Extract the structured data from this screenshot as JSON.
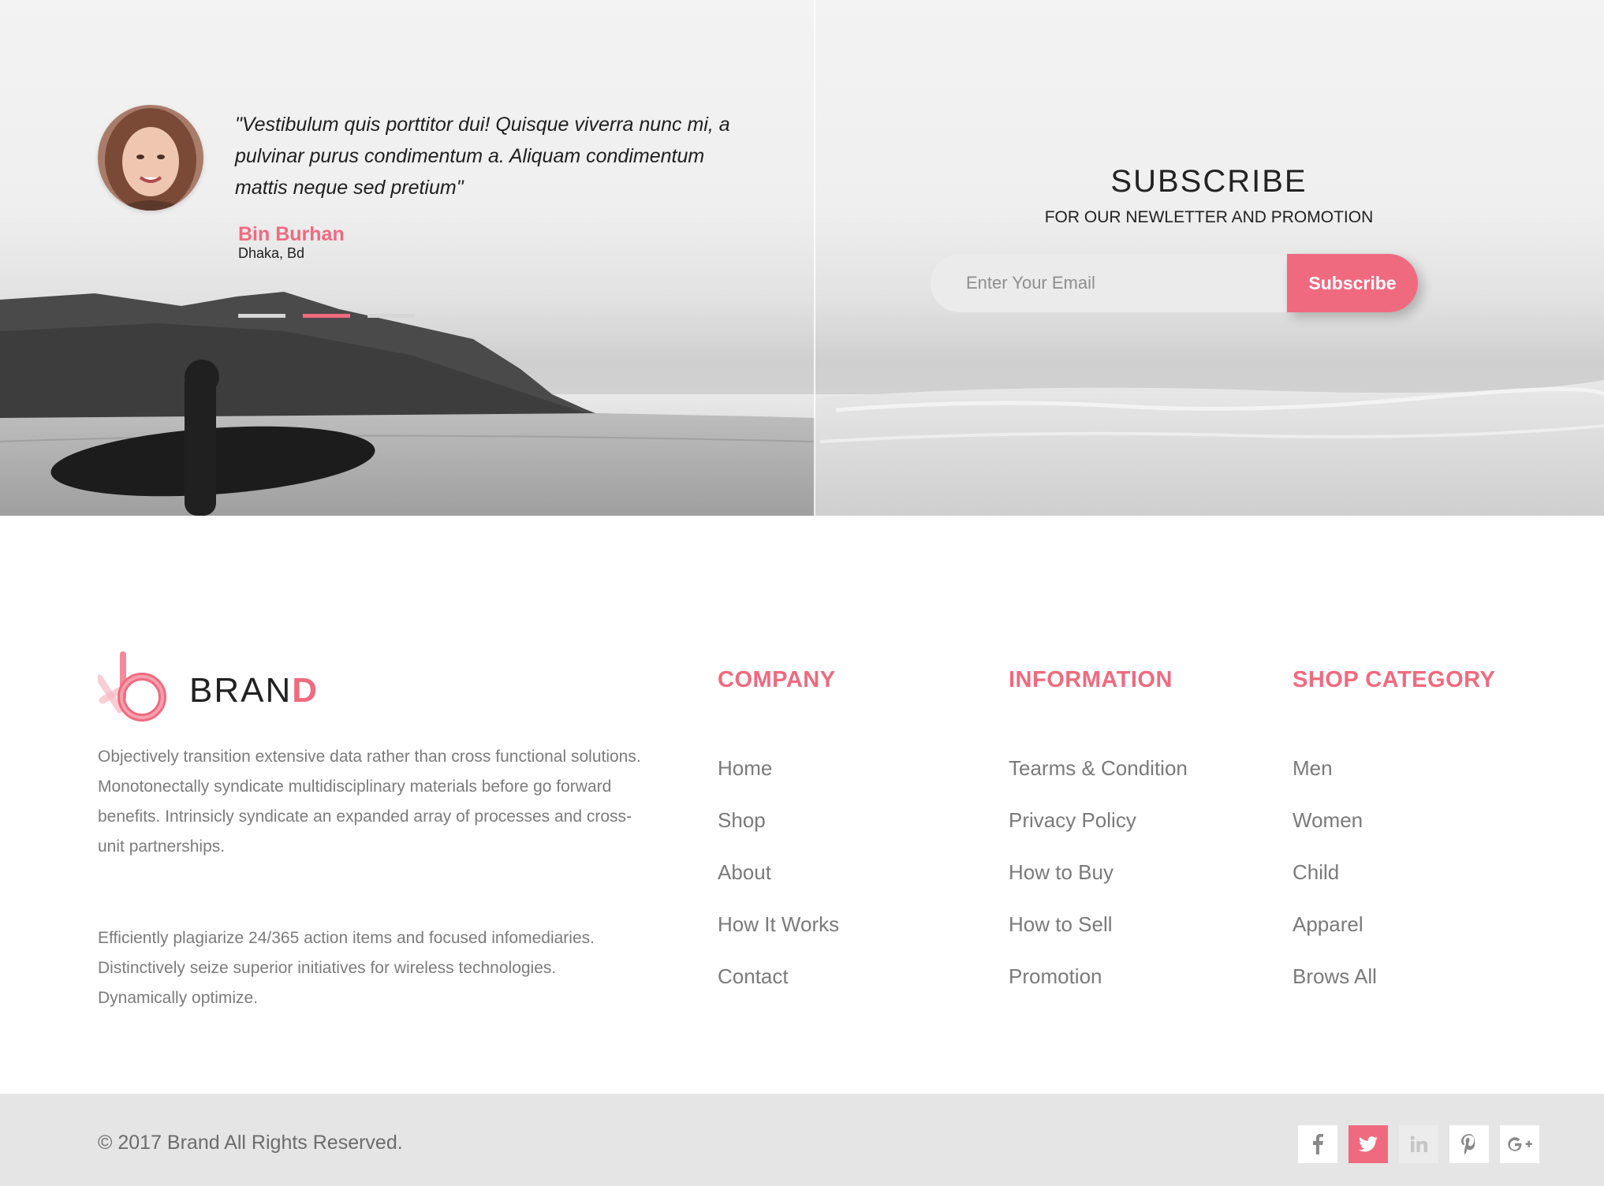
{
  "testimonial": {
    "quote": "\"Vestibulum quis porttitor dui! Quisque viverra nunc mi, a pulvinar purus condimentum a. Aliquam condimentum mattis neque sed pretium\"",
    "author": "Bin Burhan",
    "location": "Dhaka, Bd",
    "slides": 3,
    "active_slide": 2
  },
  "subscribe": {
    "title": "SUBSCRIBE",
    "subtitle": "FOR OUR NEWLETTER AND PROMOTION",
    "email_placeholder": "Enter Your Email",
    "button_label": "Subscribe"
  },
  "brand": {
    "name_main": "BRAN",
    "name_accent": "D",
    "paragraph_1": "Objectively transition extensive data rather than cross functional solutions. Monotonectally syndicate multidisciplinary materials before go forward benefits. Intrinsicly syndicate an expanded array of processes and cross-unit partnerships.",
    "paragraph_2": "Efficiently plagiarize 24/365 action items and focused infomediaries. Distinctively seize superior initiatives for wireless technologies. Dynamically optimize."
  },
  "columns": {
    "company": {
      "title": "COMPANY",
      "links": [
        "Home",
        "Shop",
        "About",
        "How It Works",
        "Contact"
      ]
    },
    "information": {
      "title": "INFORMATION",
      "links": [
        "Tearms & Condition",
        "Privacy Policy",
        "How to Buy",
        "How to Sell",
        "Promotion"
      ]
    },
    "shop_category": {
      "title": "SHOP CATEGORY",
      "links": [
        "Men",
        "Women",
        "Child",
        "Apparel",
        "Brows All"
      ]
    }
  },
  "footer": {
    "copyright": "© 2017 Brand All Rights Reserved.",
    "socials": [
      "facebook-icon",
      "twitter-icon",
      "linkedin-icon",
      "pinterest-icon",
      "google-plus-icon"
    ],
    "active_social": "twitter-icon"
  },
  "colors": {
    "accent": "#f06a7f",
    "text_dark": "#222222",
    "text_muted": "#7a7a7a",
    "bottom_bar": "#e5e5e5"
  }
}
